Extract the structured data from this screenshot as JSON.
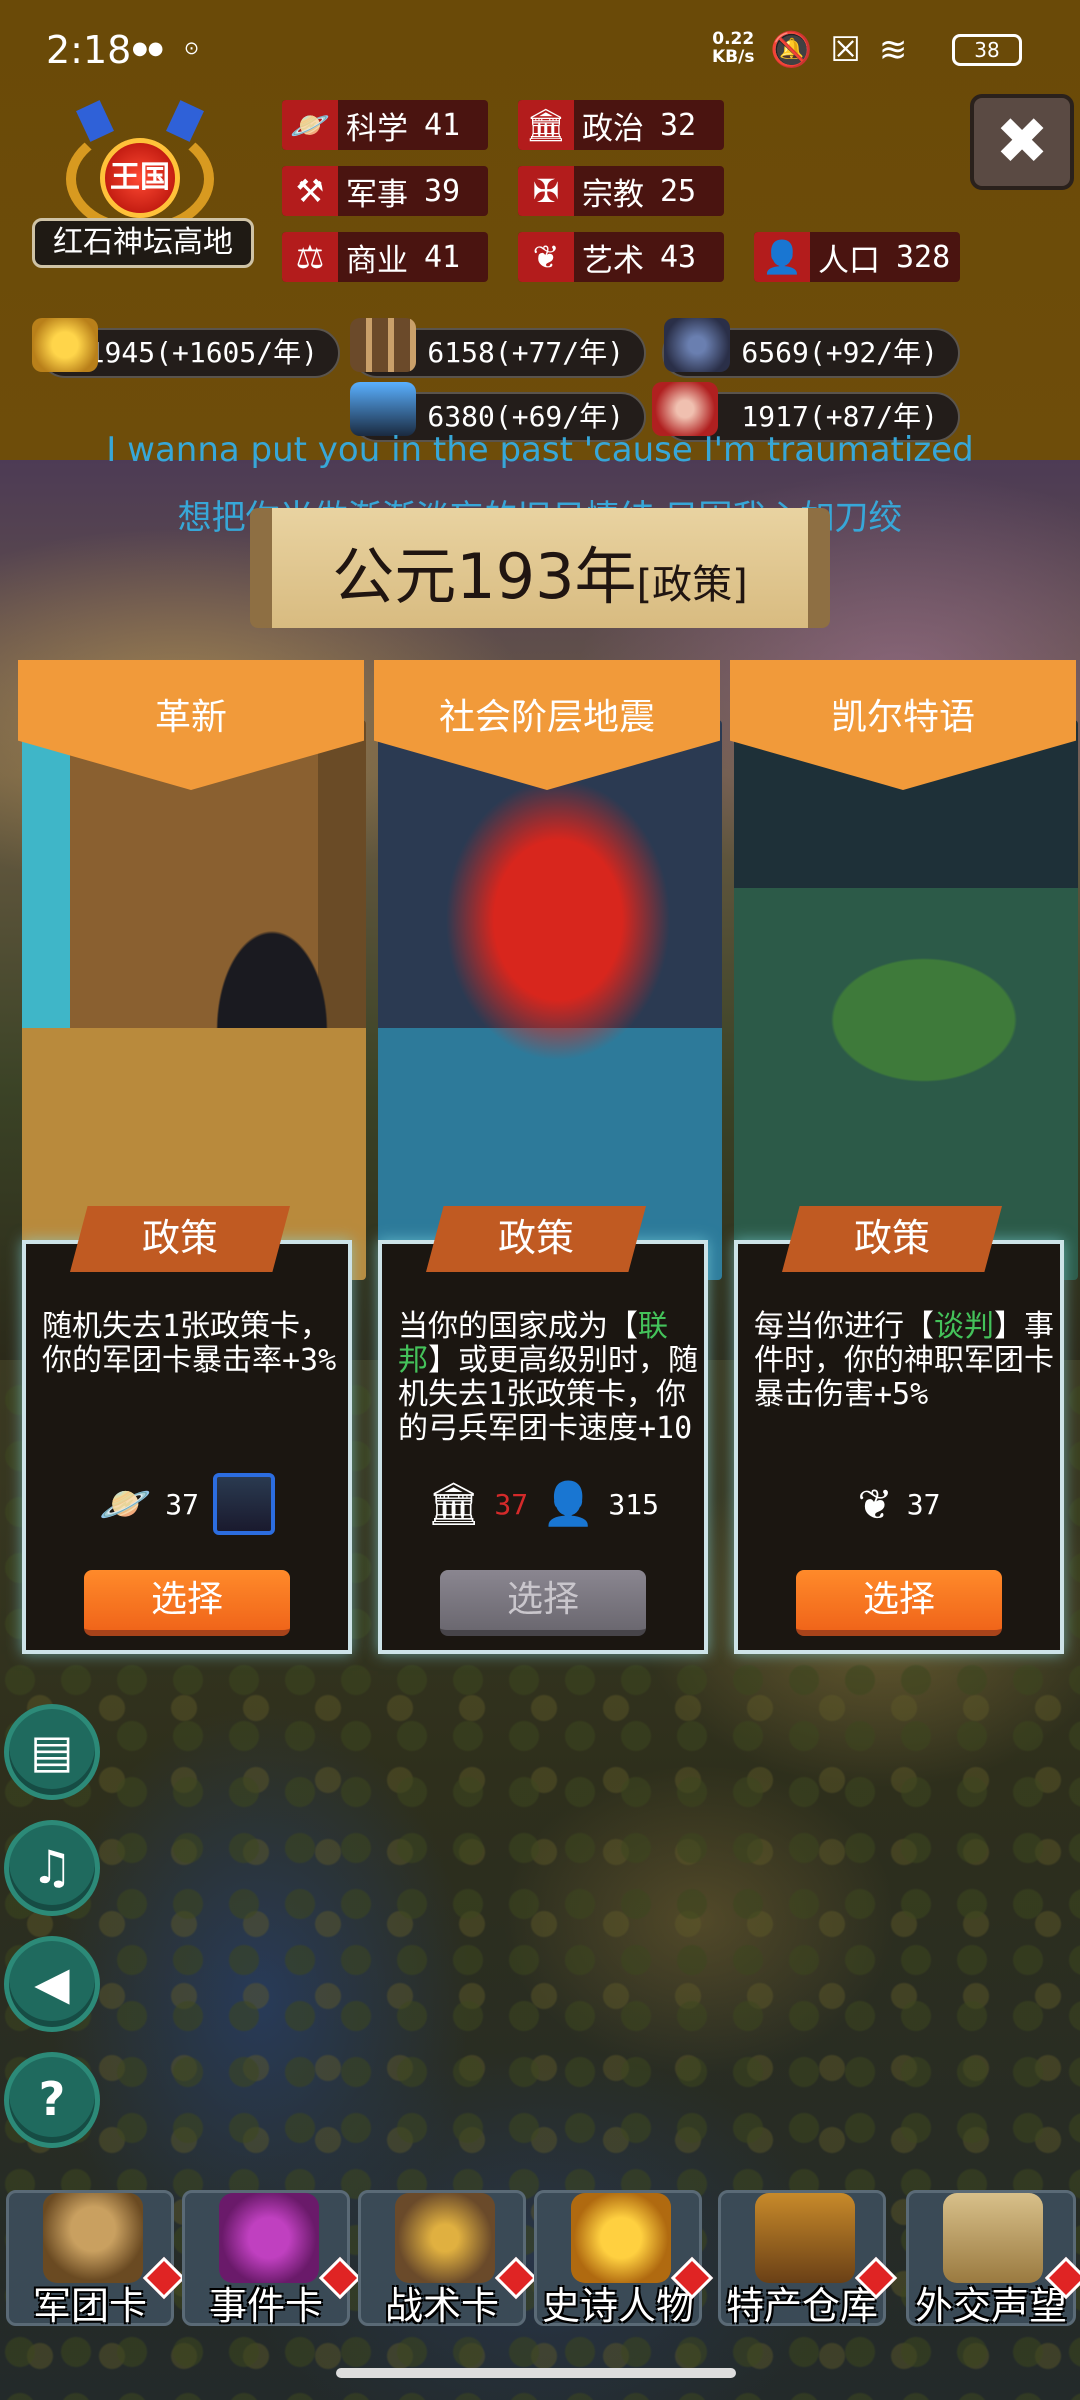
{
  "status_bar": {
    "time": "2:18",
    "net_speed_value": "0.22",
    "net_speed_unit": "KB/s",
    "battery": "38"
  },
  "kingdom": {
    "rank": "王国",
    "place_name": "红石神坛高地"
  },
  "stats": [
    {
      "icon": "science-icon",
      "glyph": "🪐",
      "label": "科学",
      "value": "41"
    },
    {
      "icon": "politics-icon",
      "glyph": "🏛",
      "label": "政治",
      "value": "32"
    },
    {
      "icon": "military-icon",
      "glyph": "⚒",
      "label": "军事",
      "value": "39"
    },
    {
      "icon": "religion-icon",
      "glyph": "✠",
      "label": "宗教",
      "value": "25"
    },
    {
      "icon": "commerce-icon",
      "glyph": "⚖",
      "label": "商业",
      "value": "41"
    },
    {
      "icon": "art-icon",
      "glyph": "❦",
      "label": "艺术",
      "value": "43"
    },
    {
      "icon": "population-icon",
      "glyph": "👤",
      "label": "人口",
      "value": "328"
    }
  ],
  "resources": [
    {
      "icon": "gold-coins-icon",
      "text": "61945(+1605/年)"
    },
    {
      "icon": "wood-logs-icon",
      "text": "6158(+77/年)"
    },
    {
      "icon": "stone-ore-icon",
      "text": "6569(+92/年)"
    },
    {
      "icon": "gem-chest-icon",
      "text": "6380(+69/年)"
    },
    {
      "icon": "meat-icon",
      "text": "1917(+87/年)"
    }
  ],
  "lyrics": {
    "line1": "I wanna put you in the past 'cause I'm traumatized",
    "line2": "想把你当做渐渐淡忘的旧日情结 只因我心如刀绞"
  },
  "year": {
    "main": "公元193年",
    "sub": "[政策]"
  },
  "cards": [
    {
      "title": "革新",
      "type": "政策",
      "desc_parts": [
        "随机失去1张政策卡，你的军团卡暴击率+3%"
      ],
      "requirements": [
        {
          "icon": "science-icon",
          "glyph": "🪐",
          "value": "37"
        }
      ],
      "has_card_req": true,
      "button": "选择",
      "enabled": true
    },
    {
      "title": "社会阶层地震",
      "type": "政策",
      "desc_pre": "当你的国家成为【",
      "desc_hl": "联邦",
      "desc_post": "】或更高级别时，随机失去1张政策卡，你的弓兵军团卡速度+10",
      "requirements": [
        {
          "icon": "politics-icon",
          "glyph": "🏛",
          "value": "37",
          "insufficient": true
        },
        {
          "icon": "population-icon",
          "glyph": "👤",
          "value": "315"
        }
      ],
      "button": "选择",
      "enabled": false
    },
    {
      "title": "凯尔特语",
      "type": "政策",
      "desc_pre": "每当你进行【",
      "desc_hl": "谈判",
      "desc_post": "】事件时，你的神职军团卡暴击伤害+5%",
      "requirements": [
        {
          "icon": "art-icon",
          "glyph": "❦",
          "value": "37"
        }
      ],
      "button": "选择",
      "enabled": true
    }
  ],
  "side_buttons": [
    {
      "icon": "card-deck-icon",
      "glyph": "▤"
    },
    {
      "icon": "music-off-icon",
      "glyph": "♫"
    },
    {
      "icon": "sound-icon",
      "glyph": "◀"
    },
    {
      "icon": "help-icon",
      "glyph": "?"
    }
  ],
  "bottom_nav": [
    {
      "icon": "helmet-icon",
      "label": "军团卡"
    },
    {
      "icon": "scroll-icon",
      "label": "事件卡"
    },
    {
      "icon": "shield-crest-icon",
      "label": "战术卡"
    },
    {
      "icon": "crown-icon",
      "label": "史诗人物"
    },
    {
      "icon": "treasure-chest-icon",
      "label": "特产仓库"
    },
    {
      "icon": "envelope-icon",
      "label": "外交声望"
    }
  ],
  "colors": {
    "topbar": "#6a4a08",
    "stat_icon_bg": "#b31c1c",
    "card_header": "#f19a3a",
    "button_orange": "#f0651a",
    "highlight_green": "#44c25a",
    "lyric_blue": "#37a7d8"
  }
}
